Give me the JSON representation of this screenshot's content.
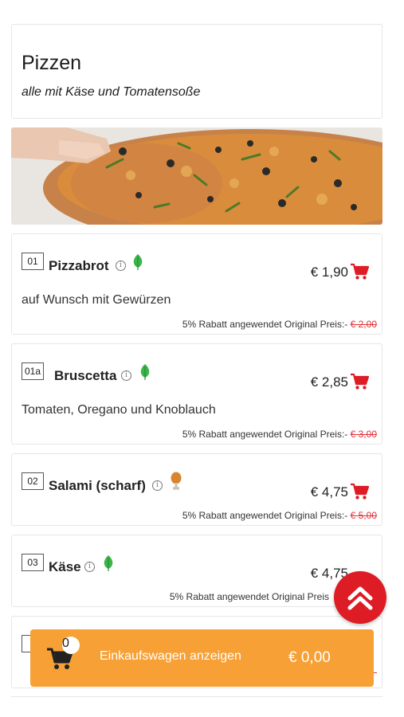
{
  "category": {
    "title": "Pizzen",
    "subtitle": "alle mit Käse und Tomatensoße"
  },
  "items": [
    {
      "number": "01",
      "name": "Pizzabrot",
      "diet_icon": "leaf-icon",
      "price": "€ 1,90",
      "description": "auf Wunsch mit Gewürzen",
      "discount_text": "5% Rabatt angewendet Original Preis:-",
      "original_price": "€ 2,00"
    },
    {
      "number": "01a",
      "name": "Bruscetta",
      "diet_icon": "leaf-icon",
      "price": "€ 2,85",
      "description": "Tomaten, Oregano und Knoblauch",
      "discount_text": "5% Rabatt angewendet Original Preis:-",
      "original_price": "€ 3,00"
    },
    {
      "number": "02",
      "name": "Salami (scharf)",
      "diet_icon": "drumstick-icon",
      "price": "€ 4,75",
      "description": "",
      "discount_text": "5% Rabatt angewendet Original Preis:-",
      "original_price": "€ 5,00"
    },
    {
      "number": "03",
      "name": "Käse",
      "diet_icon": "leaf-icon",
      "price": "€ 4,75",
      "description": "",
      "discount_text": "5% Rabatt angewendet Original Preis",
      "original_price": ""
    },
    {
      "number": "0"
    }
  ],
  "cart": {
    "count": "0",
    "label": "Einkaufswagen anzeigen",
    "total": "€ 0,00"
  },
  "colors": {
    "accent_red": "#dd1c25",
    "cart_orange": "#f7a035",
    "strike_red": "#e0313b",
    "leaf_green": "#3bb54a"
  }
}
